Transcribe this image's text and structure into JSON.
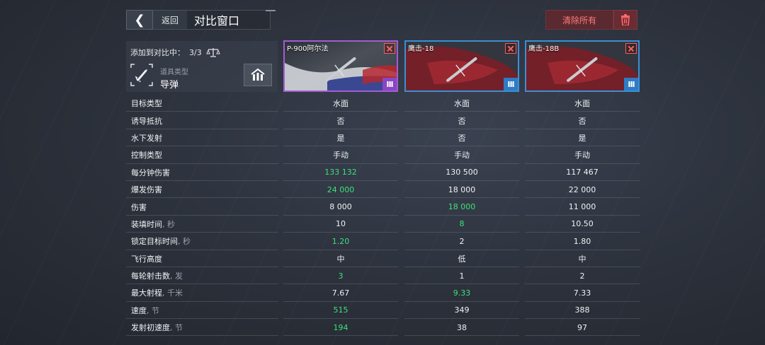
{
  "topbar": {
    "back_label": "返回",
    "title": "对比窗口",
    "clear_label": "清除所有"
  },
  "info": {
    "added_label": "添加到对比中：",
    "added_count": "3/3",
    "type_label": "道具类型",
    "type_value": "导弹"
  },
  "cards": [
    {
      "name": "P-900阿尔法",
      "tier": "III",
      "rarity_color": "#a25cd4"
    },
    {
      "name": "鹰击-18",
      "tier": "III",
      "rarity_color": "#3b8fd6"
    },
    {
      "name": "鹰击-18B",
      "tier": "III",
      "rarity_color": "#3b8fd6"
    }
  ],
  "colors": {
    "best": "#3ee07a",
    "danger": "#ff7a7a",
    "accent_blue": "#3b8fd6"
  },
  "stats": [
    {
      "label": "目标类型",
      "unit": "",
      "values": [
        "水面",
        "水面",
        "水面"
      ],
      "best": [
        false,
        false,
        false
      ]
    },
    {
      "label": "诱导抵抗",
      "unit": "",
      "values": [
        "否",
        "否",
        "否"
      ],
      "best": [
        false,
        false,
        false
      ]
    },
    {
      "label": "水下发射",
      "unit": "",
      "values": [
        "是",
        "否",
        "是"
      ],
      "best": [
        false,
        false,
        false
      ]
    },
    {
      "label": "控制类型",
      "unit": "",
      "values": [
        "手动",
        "手动",
        "手动"
      ],
      "best": [
        false,
        false,
        false
      ]
    },
    {
      "label": "每分钟伤害",
      "unit": "",
      "values": [
        "133 132",
        "130 500",
        "117 467"
      ],
      "best": [
        true,
        false,
        false
      ]
    },
    {
      "label": "爆发伤害",
      "unit": "",
      "values": [
        "24 000",
        "18 000",
        "22 000"
      ],
      "best": [
        true,
        false,
        false
      ]
    },
    {
      "label": "伤害",
      "unit": "",
      "values": [
        "8 000",
        "18 000",
        "11 000"
      ],
      "best": [
        false,
        true,
        false
      ]
    },
    {
      "label": "装填时间",
      "unit": ", 秒",
      "values": [
        "10",
        "8",
        "10.50"
      ],
      "best": [
        false,
        true,
        false
      ]
    },
    {
      "label": "锁定目标时间",
      "unit": ", 秒",
      "values": [
        "1.20",
        "2",
        "1.80"
      ],
      "best": [
        true,
        false,
        false
      ]
    },
    {
      "label": "飞行高度",
      "unit": "",
      "values": [
        "中",
        "低",
        "中"
      ],
      "best": [
        false,
        false,
        false
      ]
    },
    {
      "label": "每轮射击数",
      "unit": ", 发",
      "values": [
        "3",
        "1",
        "2"
      ],
      "best": [
        true,
        false,
        false
      ]
    },
    {
      "label": "最大射程",
      "unit": ", 千米",
      "values": [
        "7.67",
        "9.33",
        "7.33"
      ],
      "best": [
        false,
        true,
        false
      ]
    },
    {
      "label": "速度",
      "unit": ", 节",
      "values": [
        "515",
        "349",
        "388"
      ],
      "best": [
        true,
        false,
        false
      ]
    },
    {
      "label": "发射初速度",
      "unit": ", 节",
      "values": [
        "194",
        "38",
        "97"
      ],
      "best": [
        true,
        false,
        false
      ]
    }
  ]
}
